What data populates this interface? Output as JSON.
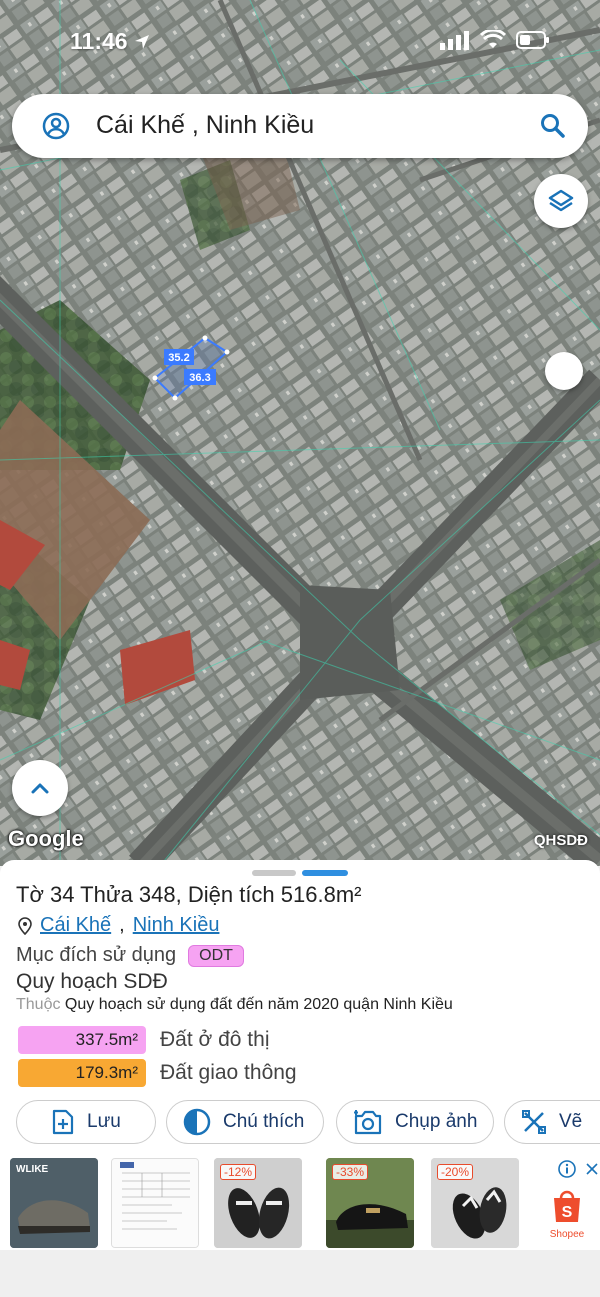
{
  "status": {
    "time": "11:46"
  },
  "search": {
    "query": "Cái Khế , Ninh Kiều"
  },
  "map": {
    "parcel_labels": [
      "35.2",
      "36.3"
    ],
    "logo": "Google",
    "attribution": "QHSDĐ"
  },
  "parcel": {
    "title": "Tờ 34 Thửa 348, Diện tích 516.8m²",
    "ward": "Cái Khế",
    "separator": ",",
    "district": "Ninh Kiều",
    "purpose_label": "Mục đích sử dụng",
    "purpose_code": "ODT",
    "plan_title": "Quy hoạch SDĐ",
    "plan_prefix": "Thuộc",
    "plan_name": "Quy hoạch sử dụng đất đến năm 2020 quận Ninh Kiều",
    "zones": [
      {
        "area": "337.5m²",
        "label": "Đất ở đô thị",
        "color": "#f6a3f2"
      },
      {
        "area": "179.3m²",
        "label": "Đất giao thông",
        "color": "#f8a833"
      }
    ]
  },
  "actions": [
    {
      "label": "Lưu",
      "icon": "save-icon"
    },
    {
      "label": "Chú thích",
      "icon": "legend-icon"
    },
    {
      "label": "Chụp ảnh",
      "icon": "camera-icon"
    },
    {
      "label": "Vẽ",
      "icon": "draw-icon"
    }
  ],
  "ads": {
    "items": [
      {
        "badge": "",
        "brand": "WLIKE"
      },
      {
        "badge": "",
        "brand": ""
      },
      {
        "badge": "-12%",
        "brand": ""
      },
      {
        "badge": "-33%",
        "brand": ""
      },
      {
        "badge": "-20%",
        "brand": ""
      }
    ],
    "shop_name": "Shopee",
    "info_icon": "info-icon"
  },
  "colors": {
    "accent": "#1a73b8",
    "parcel_outline": "#3b7bff",
    "odt": "#f6a3f2",
    "road": "#f8a833"
  }
}
